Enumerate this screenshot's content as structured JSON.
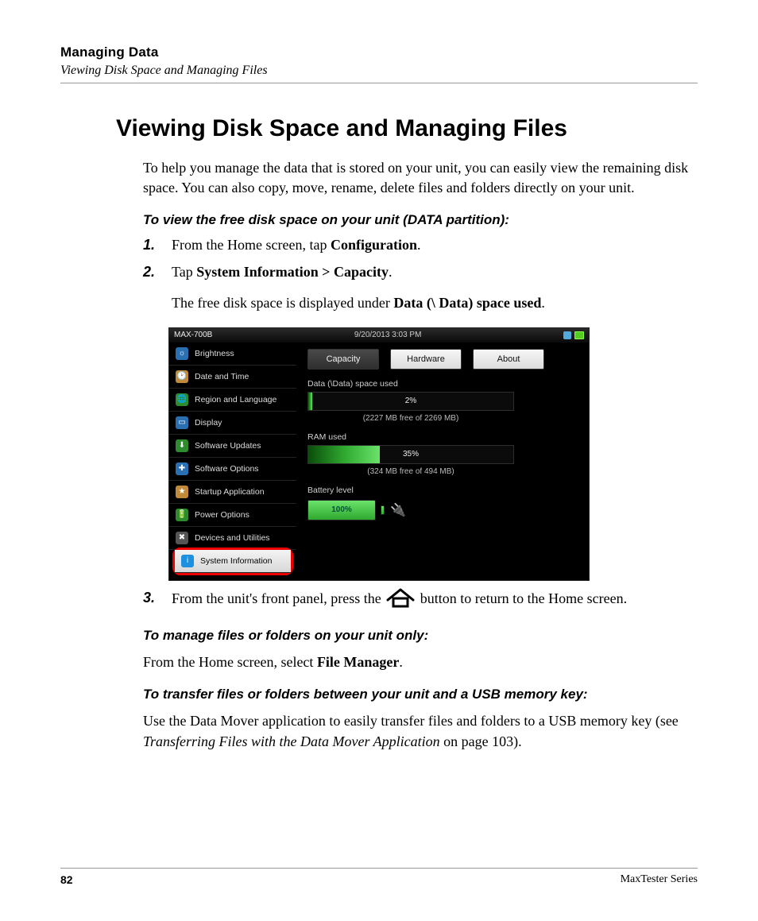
{
  "header": {
    "chapter": "Managing Data",
    "section": "Viewing Disk Space and Managing Files"
  },
  "heading": "Viewing Disk Space and Managing Files",
  "intro": "To help you manage the data that is stored on your unit, you can easily view the remaining disk space. You can also copy, move, rename, delete files and folders directly on your unit.",
  "sub1": "To view the free disk space on your unit (DATA partition):",
  "step1": {
    "num": "1.",
    "pre": "From the Home screen, tap ",
    "bold": "Configuration",
    "post": "."
  },
  "step2": {
    "num": "2.",
    "pre": "Tap ",
    "bold": "System Information > Capacity",
    "post": ".",
    "line2_pre": "The free disk space is displayed under ",
    "line2_bold": "Data (\\ Data) space used",
    "line2_post": "."
  },
  "device": {
    "title": "MAX-700B",
    "clock": "9/20/2013 3:03 PM",
    "sidebar": [
      {
        "label": "Brightness",
        "icon_bg": "#2b6fb3",
        "glyph": "☼"
      },
      {
        "label": "Date and Time",
        "icon_bg": "#c08a3a",
        "glyph": "🕑"
      },
      {
        "label": "Region and Language",
        "icon_bg": "#2e8b2e",
        "glyph": "🌐"
      },
      {
        "label": "Display",
        "icon_bg": "#2b6fb3",
        "glyph": "▭"
      },
      {
        "label": "Software Updates",
        "icon_bg": "#2e8b2e",
        "glyph": "⬇"
      },
      {
        "label": "Software Options",
        "icon_bg": "#2b6fb3",
        "glyph": "✚"
      },
      {
        "label": "Startup Application",
        "icon_bg": "#c08a3a",
        "glyph": "★"
      },
      {
        "label": "Power Options",
        "icon_bg": "#2e8b2e",
        "glyph": "🔋"
      },
      {
        "label": "Devices and Utilities",
        "icon_bg": "#555555",
        "glyph": "✖"
      },
      {
        "label": "System Information",
        "icon_bg": "#1e90e0",
        "glyph": "i",
        "selected": true
      }
    ],
    "tabs": {
      "capacity": "Capacity",
      "hardware": "Hardware",
      "about": "About"
    },
    "data_label": "Data (\\Data) space used",
    "data_pct": "2%",
    "data_caption": "(2227 MB free of 2269 MB)",
    "ram_label": "RAM used",
    "ram_pct": "35%",
    "ram_caption": "(324 MB free of 494 MB)",
    "batt_label": "Battery level",
    "batt_pct": "100%"
  },
  "step3": {
    "num": "3.",
    "pre": "From the unit's front panel, press the ",
    "post": " button to return to the Home screen."
  },
  "sub2": "To manage files or folders on your unit only:",
  "manage": {
    "pre": "From the Home screen, select ",
    "bold": "File Manager",
    "post": "."
  },
  "sub3": "To transfer files or folders between your unit and a USB memory key:",
  "transfer": {
    "pre": "Use the Data Mover application to easily transfer files and folders to a USB memory key (see ",
    "ital": "Transferring Files with the Data Mover Application",
    "post": " on page 103)."
  },
  "footer": {
    "page": "82",
    "series": "MaxTester Series"
  },
  "chart_data": {
    "type": "bar",
    "series": [
      {
        "name": "Data (\\Data) space used",
        "value_pct": 2,
        "free_mb": 2227,
        "total_mb": 2269
      },
      {
        "name": "RAM used",
        "value_pct": 35,
        "free_mb": 324,
        "total_mb": 494
      },
      {
        "name": "Battery level",
        "value_pct": 100
      }
    ],
    "xlabel": "",
    "ylabel": "percent",
    "ylim": [
      0,
      100
    ]
  }
}
